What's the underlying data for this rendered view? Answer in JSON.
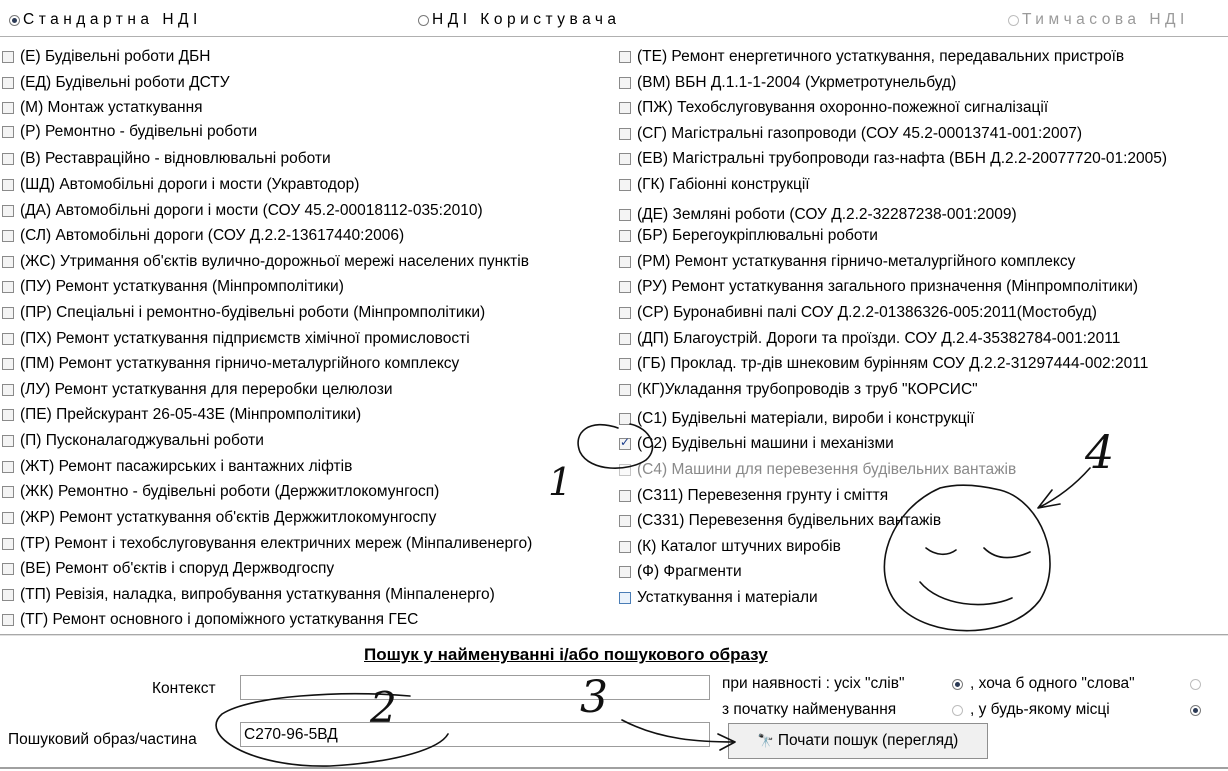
{
  "modes": [
    {
      "label": "Стандартна НДІ",
      "checked": true,
      "disabled": false
    },
    {
      "label": "НДІ Користувача",
      "checked": false,
      "disabled": false
    },
    {
      "label": "Тимчасова НДІ",
      "checked": false,
      "disabled": true
    }
  ],
  "left_items": [
    "(Е) Будівельні роботи ДБН",
    "(ЕД) Будівельні роботи ДСТУ",
    "(М) Монтаж устаткування",
    "(Р) Ремонтно - будівельні роботи",
    "(В) Реставраційно - відновлювальні роботи",
    "(ШД) Автомобільні дороги і мости (Укравтодор)",
    "(ДА) Автомобільні дороги і мости (СОУ 45.2-00018112-035:2010)",
    "(СЛ) Автомобільні дороги (СОУ Д.2.2-13617440:2006)",
    "(ЖС) Утримання об'єктів вулично-дорожньої мережі населених пунктів",
    "(ПУ) Ремонт устаткування (Мінпромполітики)",
    "(ПР) Спеціальні і ремонтно-будівельні роботи (Мінпромполітики)",
    "(ПХ) Ремонт устаткування підприємств хімічної промисловості",
    "(ПМ) Ремонт устаткування  гірничо-металургійного комплексу",
    "(ЛУ) Ремонт устаткування для переробки целюлози",
    "(ПЕ) Прейскурант 26-05-43Е (Мінпромполітики)",
    "(П) Пусконалагоджувальні роботи",
    "(ЖТ) Ремонт пасажирських і вантажних ліфтів",
    "(ЖК) Ремонтно - будівельні роботи (Держжитлокомунгосп)",
    "(ЖР) Ремонт устаткування об'єктів Держжитлокомунгоспу",
    "(ТР) Ремонт і техобслуговування електричних мереж (Мінпаливенерго)",
    "(ВЕ) Ремонт об'єктів і споруд Держводгоспу",
    "(ТП) Ревізія, наладка, випробування устаткування (Мінпаленерго)",
    "(ТГ) Ремонт основного і допоміжного устаткування ГЕС"
  ],
  "right_items": [
    {
      "label": "(ТЕ) Ремонт енергетичного устаткування, передавальних пристроїв",
      "checked": false,
      "disabled": false
    },
    {
      "label": "(ВМ) ВБН Д.1.1-1-2004 (Укрметротунельбуд)",
      "checked": false,
      "disabled": false
    },
    {
      "label": "(ПЖ) Техобслуговування охоронно-пожежної сигналізації",
      "checked": false,
      "disabled": false
    },
    {
      "label": "(СГ) Магістральні газопроводи  (СОУ 45.2-00013741-001:2007)",
      "checked": false,
      "disabled": false
    },
    {
      "label": "(ЕВ) Магістральні трубопроводи газ-нафта (ВБН Д.2.2-20077720-01:2005)",
      "checked": false,
      "disabled": false
    },
    {
      "label": "(ГК) Габіонні конструкції",
      "checked": false,
      "disabled": false
    },
    {
      "label": "(ДЕ) Земляні роботи  (СОУ Д.2.2-32287238-001:2009)",
      "checked": false,
      "disabled": false
    },
    {
      "label": "(БР) Берегоукріплювальні роботи",
      "checked": false,
      "disabled": false
    },
    {
      "label": "(РМ) Ремонт устаткування  гірничо-металургійного комплексу",
      "checked": false,
      "disabled": false
    },
    {
      "label": "(РУ) Ремонт устаткування загального призначення (Мінпромполітики)",
      "checked": false,
      "disabled": false
    },
    {
      "label": "(СР) Буронабивні палі  СОУ Д.2.2-01386326-005:2011(Мостобуд)",
      "checked": false,
      "disabled": false
    },
    {
      "label": "(ДП) Благоустрій. Дороги та проїзди. СОУ Д.2.4-35382784-001:2011",
      "checked": false,
      "disabled": false
    },
    {
      "label": "(ГБ) Проклад. тр-дів шнековим бурінням СОУ Д.2.2-31297444-002:2011",
      "checked": false,
      "disabled": false
    },
    {
      "label": "(КГ)Укладання трубопроводів з труб \"КОРСИС\"",
      "checked": false,
      "disabled": false
    },
    {
      "label": "(С1) Будівельні матеріали, вироби і конструкції",
      "checked": false,
      "disabled": false
    },
    {
      "label": "(С2) Будівельні машини і механізми",
      "checked": true,
      "disabled": false
    },
    {
      "label": "(С4) Машини для перевезення будівельних вантажів",
      "checked": false,
      "disabled": true
    },
    {
      "label": "(С311) Перевезення грунту і сміття",
      "checked": false,
      "disabled": false
    },
    {
      "label": "(С331) Перевезення будівельних вантажів",
      "checked": false,
      "disabled": false
    },
    {
      "label": "(К) Каталог штучних виробів",
      "checked": false,
      "disabled": false
    },
    {
      "label": "(Ф) Фрагменти",
      "checked": false,
      "disabled": false
    },
    {
      "label": "Устаткування і матеріали",
      "checked": false,
      "disabled": false,
      "blue": true
    }
  ],
  "search": {
    "title": "Пошук у найменуванні і/або пошукового образу",
    "context_label": "Контекст",
    "context_value": "",
    "pattern_label": "Пошуковий образ/частина",
    "pattern_value": "С270-96-5ВД",
    "presence_label": "при наявності : усіх \"слів\"",
    "any_word_label": ", хоча б одного \"слова\"",
    "start_label": "з початку найменування",
    "anywhere_label": ", у будь-якому місці",
    "all_words_checked": true,
    "any_word_checked": false,
    "start_checked": false,
    "anywhere_checked": true,
    "button_label": "Почати пошук (перегляд)",
    "button_icon": "binoculars-icon"
  },
  "annotations": {
    "mark_1": "1",
    "mark_2": "2",
    "mark_3": "3",
    "mark_4": "4"
  }
}
